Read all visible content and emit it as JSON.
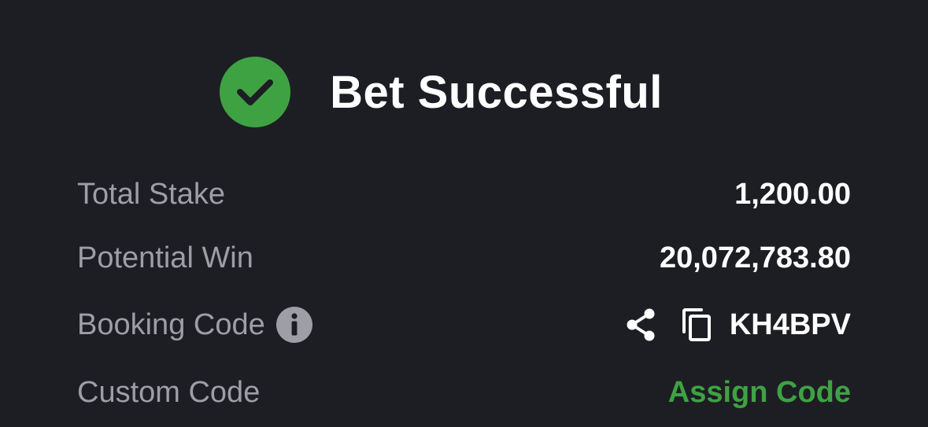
{
  "header": {
    "title": "Bet Successful",
    "icon": "check-circle-icon",
    "accent_color": "#3ea243"
  },
  "summary": {
    "total_stake": {
      "label": "Total Stake",
      "value": "1,200.00"
    },
    "potential_win": {
      "label": "Potential Win",
      "value": "20,072,783.80"
    },
    "booking_code": {
      "label": "Booking Code",
      "value": "KH4BPV",
      "info_icon": "info-icon",
      "share_icon": "share-icon",
      "copy_icon": "copy-icon"
    },
    "custom_code": {
      "label": "Custom Code",
      "action": "Assign Code"
    }
  },
  "colors": {
    "background": "#1d1e23",
    "label": "#9d9ea6",
    "value": "#ffffff",
    "success": "#3ea243"
  }
}
